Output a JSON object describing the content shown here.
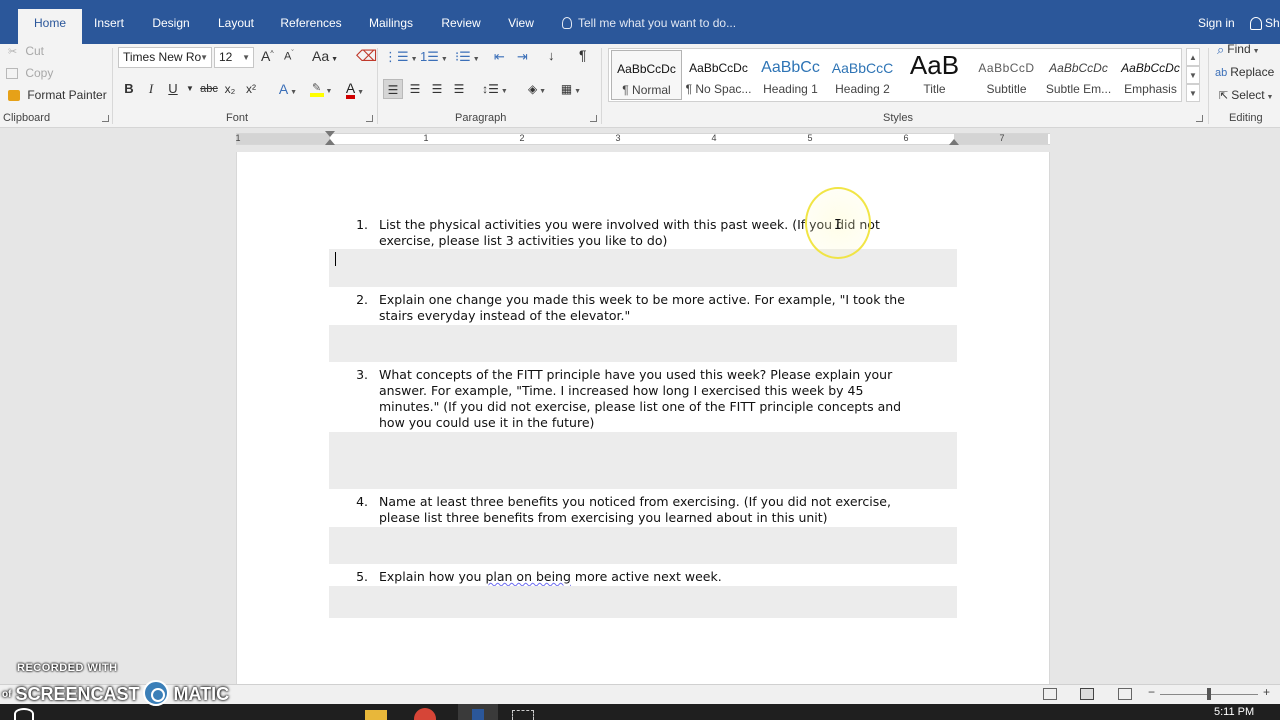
{
  "tabs": [
    "Home",
    "Insert",
    "Design",
    "Layout",
    "References",
    "Mailings",
    "Review",
    "View"
  ],
  "active_tab": "Home",
  "tell_me": "Tell me what you want to do...",
  "sign_in": "Sign in",
  "share": "Sh",
  "clipboard": {
    "cut": "Cut",
    "copy": "Copy",
    "format_painter": "Format Painter",
    "label": "Clipboard"
  },
  "font": {
    "name": "Times New Ro",
    "size": "12",
    "label": "Font",
    "grow": "A",
    "shrink": "A",
    "case": "Aa",
    "bold": "B",
    "italic": "I",
    "underline": "U",
    "strike": "abc",
    "sub": "x₂",
    "sup": "x²",
    "color_a": "A",
    "highlight_color": "#ffff00",
    "font_color": "#d00000"
  },
  "paragraph": {
    "label": "Paragraph"
  },
  "styles": {
    "label": "Styles",
    "items": [
      {
        "preview": "AaBbCcDc",
        "name": "¶ Normal"
      },
      {
        "preview": "AaBbCcDc",
        "name": "¶ No Spac..."
      },
      {
        "preview": "AaBbCc",
        "name": "Heading 1"
      },
      {
        "preview": "AaBbCcC",
        "name": "Heading 2"
      },
      {
        "preview": "AaB",
        "name": "Title"
      },
      {
        "preview": "AaBbCcD",
        "name": "Subtitle"
      },
      {
        "preview": "AaBbCcDc",
        "name": "Subtle Em..."
      },
      {
        "preview": "AaBbCcDc",
        "name": "Emphasis"
      }
    ]
  },
  "editing": {
    "find": "Find",
    "replace": "Replace",
    "select": "Select",
    "label": "Editing"
  },
  "ruler_numbers": [
    "1",
    "1",
    "2",
    "3",
    "4",
    "5",
    "6",
    "7"
  ],
  "document": {
    "questions": [
      {
        "num": "1.",
        "lines": [
          "List the physical activities you were involved with this past week. (If you did not",
          "exercise, please list 3 activities you like to do)"
        ]
      },
      {
        "num": "2.",
        "lines": [
          "Explain one change you made this week to be more active. For example, \"I took the",
          "stairs everyday instead of the elevator.\""
        ]
      },
      {
        "num": "3.",
        "lines": [
          "What concepts of the FITT principle have you used this week? Please explain your",
          "answer. For example, \"Time. I increased how long I exercised this week by 45",
          "minutes.\" (If you did not exercise, please list one of the FITT principle concepts and",
          "how you could use it in the future)"
        ]
      },
      {
        "num": "4.",
        "lines": [
          "Name at least three benefits you noticed from exercising. (If you did not exercise,",
          "please list three benefits from exercising you learned about in this unit)"
        ]
      },
      {
        "num": "5.",
        "q5_before": "Explain how you ",
        "q5_squiggle": "plan on being",
        "q5_after": " more active next week."
      }
    ]
  },
  "watermark": {
    "top": "RECORDED WITH",
    "of": "of",
    "left": "SCREENCAST",
    "right": "MATIC"
  },
  "clock": "5:11 PM"
}
